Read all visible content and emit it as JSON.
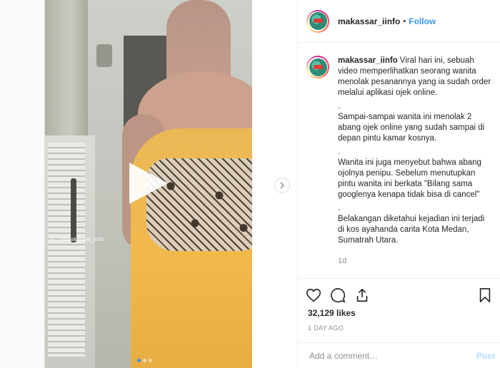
{
  "media": {
    "watermark": "IG : @makassar_iinfo",
    "carousel_total": 3,
    "carousel_active": 1
  },
  "header": {
    "username": "makassar_iinfo",
    "separator": "•",
    "follow_label": "Follow"
  },
  "caption": {
    "username": "makassar_iinfo",
    "paragraph_1": "Viral hari ini, sebuah video memperlihatkan seorang wanita menolak pesanannya yang ia sudah order melalui aplikasi ojek online.",
    "dot": ".",
    "paragraph_2": "Sampai-sampai wanita ini menolak 2 abang ojek online yang sudah sampai di depan pintu kamar kosnya.",
    "paragraph_3": "Wanita ini juga menyebut bahwa abang ojolnya penipu. Sebelum menutupkan pintu wanita ini berkata \"Bilang sama googlenya kenapa tidak bisa di cancel\"",
    "paragraph_4": "Belakangan diketahui kejadian ini terjadi di kos ayahanda carita Kota Medan, Sumatrah Utara.",
    "age": "1d"
  },
  "icons": {
    "like": "heart-icon",
    "comment": "comment-icon",
    "share": "share-icon",
    "save": "bookmark-icon",
    "play": "play-icon",
    "next": "chevron-right-icon"
  },
  "stats": {
    "likes": "32,129 likes",
    "posted": "1 DAY AGO"
  },
  "comment": {
    "placeholder": "Add a comment…",
    "post_label": "Post"
  },
  "colors": {
    "accent": "#3897f0",
    "post_disabled": "#b3dbff",
    "muted": "#8e8e8e"
  }
}
